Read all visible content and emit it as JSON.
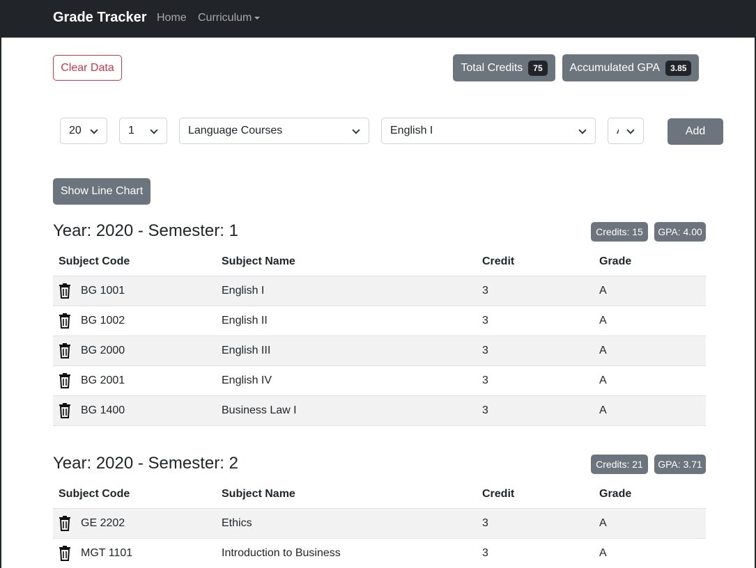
{
  "navbar": {
    "brand": "Grade Tracker",
    "home": "Home",
    "curriculum": "Curriculum"
  },
  "summary": {
    "clear_label": "Clear Data",
    "total_credits_label": "Total Credits",
    "total_credits_value": "75",
    "gpa_label": "Accumulated GPA",
    "gpa_value": "3.85"
  },
  "form": {
    "year": "20",
    "semester": "1",
    "category": "Language Courses",
    "subject": "English I",
    "grade": "A",
    "add_label": "Add"
  },
  "chart_button": "Show Line Chart",
  "columns": [
    "Subject Code",
    "Subject Name",
    "Credit",
    "Grade"
  ],
  "semesters": [
    {
      "title": "Year: 2020 - Semester: 1",
      "credits": "Credits: 15",
      "gpa": "GPA: 4.00",
      "rows": [
        {
          "code": "BG 1001",
          "name": "English I",
          "credit": "3",
          "grade": "A"
        },
        {
          "code": "BG 1002",
          "name": "English II",
          "credit": "3",
          "grade": "A"
        },
        {
          "code": "BG 2000",
          "name": "English III",
          "credit": "3",
          "grade": "A"
        },
        {
          "code": "BG 2001",
          "name": "English IV",
          "credit": "3",
          "grade": "A"
        },
        {
          "code": "BG 1400",
          "name": "Business Law I",
          "credit": "3",
          "grade": "A"
        }
      ]
    },
    {
      "title": "Year: 2020 - Semester: 2",
      "credits": "Credits: 21",
      "gpa": "GPA: 3.71",
      "rows": [
        {
          "code": "GE 2202",
          "name": "Ethics",
          "credit": "3",
          "grade": "A"
        },
        {
          "code": "MGT 1101",
          "name": "Introduction to Business",
          "credit": "3",
          "grade": "A"
        }
      ]
    }
  ],
  "icons": {
    "delete": "trash-icon",
    "dropdown": "chevron-down-icon"
  },
  "colors": {
    "navbar": "#212529",
    "secondary": "#6c757d",
    "danger": "#dc3545",
    "stripe": "#f2f2f2"
  }
}
